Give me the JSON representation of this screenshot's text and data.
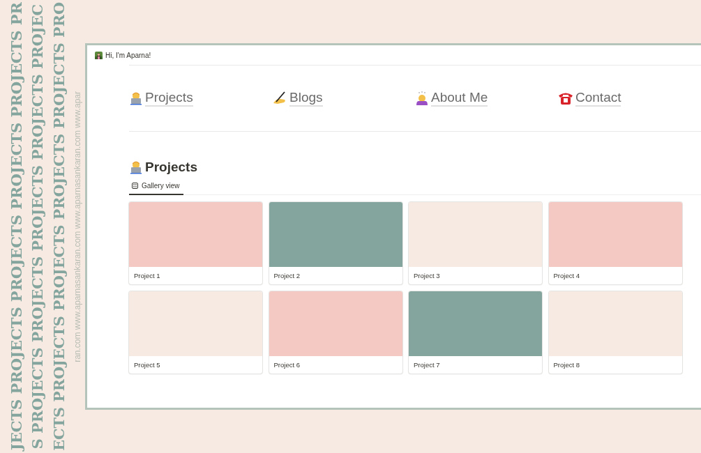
{
  "decoration": {
    "columns": [
      {
        "kind": "word",
        "text": "JECTS PROJECTS PROJECTS PROJECTS PROJECTS PR"
      },
      {
        "kind": "word",
        "text": "S PROJECTS PROJECTS PROJECTS PROJECTS PROJEC"
      },
      {
        "kind": "word",
        "text": "ECTS PROJECTS PROJECTS PROJECTS PROJECTS PRO"
      },
      {
        "kind": "url",
        "text": "ran.com www.aparnasankaran.com www.aparnasankaran.com www.apar"
      }
    ]
  },
  "header": {
    "greeting": "Hi, I'm Aparna!"
  },
  "nav": [
    {
      "label": "Projects"
    },
    {
      "label": "Blogs"
    },
    {
      "label": "About Me"
    },
    {
      "label": "Contact"
    }
  ],
  "section": {
    "title": "Projects"
  },
  "views": [
    {
      "label": "Gallery view",
      "selected": true
    }
  ],
  "cards": [
    {
      "title": "Project 1",
      "color": "#f4c9c3"
    },
    {
      "title": "Project 2",
      "color": "#84a59d"
    },
    {
      "title": "Project 3",
      "color": "#f6eae2"
    },
    {
      "title": "Project 4",
      "color": "#f4c9c3"
    },
    {
      "title": "Project 5",
      "color": "#f6eae2"
    },
    {
      "title": "Project 6",
      "color": "#f4c9c3"
    },
    {
      "title": "Project 7",
      "color": "#84a59d"
    },
    {
      "title": "Project 8",
      "color": "#f6eae2"
    }
  ]
}
